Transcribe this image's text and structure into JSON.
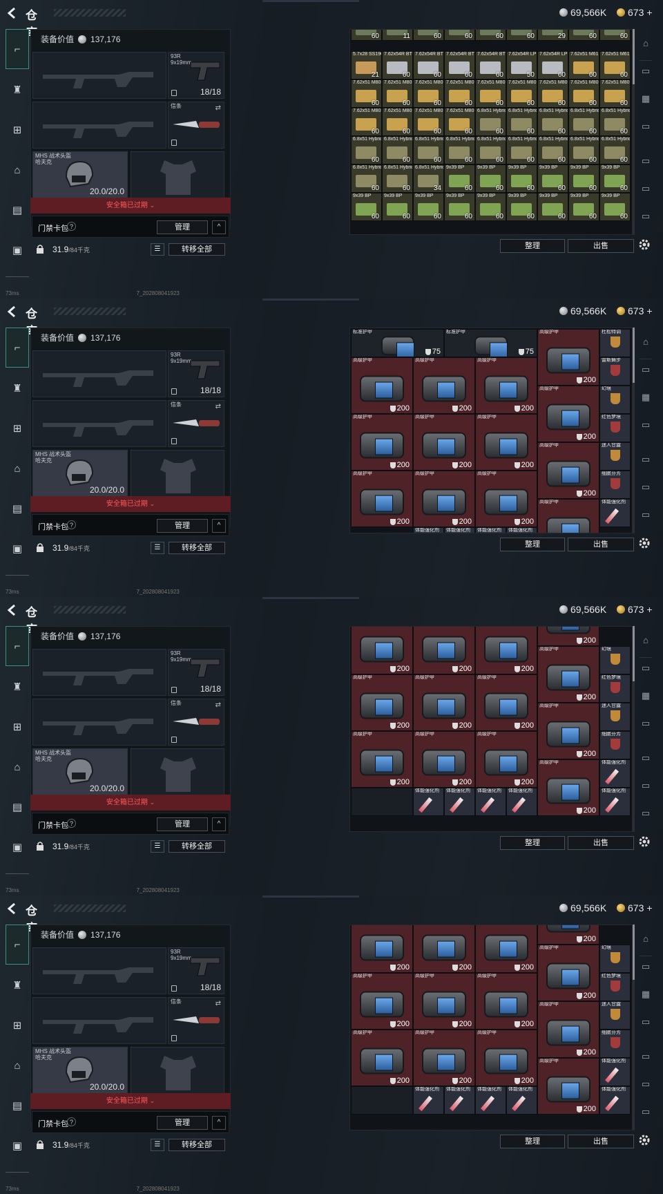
{
  "header": {
    "title": "仓库",
    "silver": "69,566K",
    "gold": "673",
    "gold_plus": "+"
  },
  "equipment": {
    "value_label": "装备价值",
    "value": "137,176",
    "secondary_name": "93R",
    "secondary_ammo": "9x19mm",
    "secondary_count": "18/18",
    "melee_name": "信条",
    "helmet_name": "MHS 战术头盔",
    "helmet_sub": "哈夫克",
    "helmet_durability": "20.0/20.0"
  },
  "safe_box": {
    "expired": "安全箱已过期"
  },
  "card_pack": {
    "label": "门禁卡包",
    "help": "?",
    "manage": "管理",
    "collapse": "^"
  },
  "weight": {
    "value": "31.9",
    "cap": "/84千克"
  },
  "buttons": {
    "transfer_all": "转移全部",
    "sort": "整理",
    "sell": "出售"
  },
  "status": {
    "ping": "73ms",
    "build": "7_202808041923"
  },
  "icons": [
    "back-icon",
    "silver-coin-icon",
    "gold-coin-icon",
    "gun-icon",
    "armor-icon",
    "rig-icon",
    "backpack-icon",
    "case-icon",
    "briefcase-icon",
    "lock-icon",
    "list-icon",
    "gear-icon"
  ],
  "frames": [
    {
      "id": "ammo",
      "cells": [
        [
          "",
          "60"
        ],
        [
          "",
          "11"
        ],
        [
          "",
          "60"
        ],
        [
          "",
          "60"
        ],
        [
          "",
          "60"
        ],
        [
          "",
          "60"
        ],
        [
          "",
          "29"
        ],
        [
          "",
          "60"
        ],
        [
          "",
          "60"
        ],
        [
          "5.7x28 SS190",
          "21"
        ],
        [
          "7.62x54R BT",
          "60"
        ],
        [
          "7.62x54R BT",
          "60"
        ],
        [
          "7.62x54R BT",
          "60"
        ],
        [
          "7.62x54R BT",
          "60"
        ],
        [
          "7.62x54R LPS",
          "50"
        ],
        [
          "7.62x54R LPS",
          "60"
        ],
        [
          "7.62x51 M61",
          "60"
        ],
        [
          "7.62x51 M61",
          "60"
        ],
        [
          "7.62x51 M80",
          "60"
        ],
        [
          "7.62x51 M80",
          "60"
        ],
        [
          "7.62x51 M80",
          "60"
        ],
        [
          "7.62x51 M80",
          "60"
        ],
        [
          "7.62x51 M80",
          "60"
        ],
        [
          "7.62x51 M80",
          "60"
        ],
        [
          "7.62x51 M80",
          "60"
        ],
        [
          "7.62x51 M80",
          "60"
        ],
        [
          "7.62x51 M80",
          "60"
        ],
        [
          "7.62x51 M80",
          "60"
        ],
        [
          "7.62x51 M80",
          "60"
        ],
        [
          "7.62x51 M80",
          "60"
        ],
        [
          "7.62x51 M80",
          "60"
        ],
        [
          "6.8x51 Hybrid",
          "60"
        ],
        [
          "6.8x51 Hybrid",
          "60"
        ],
        [
          "6.8x51 Hybrid",
          "60"
        ],
        [
          "6.8x51 Hybrid",
          "60"
        ],
        [
          "6.8x51 Hybrid",
          "60"
        ],
        [
          "6.8x51 Hybrid",
          "60"
        ],
        [
          "6.8x51 Hybrid",
          "60"
        ],
        [
          "6.8x51 Hybrid",
          "60"
        ],
        [
          "6.8x51 Hybrid",
          "60"
        ],
        [
          "6.8x51 Hybrid",
          "60"
        ],
        [
          "6.8x51 Hybrid",
          "60"
        ],
        [
          "6.8x51 Hybrid",
          "60"
        ],
        [
          "6.8x51 Hybrid",
          "60"
        ],
        [
          "6.8x51 Hybrid",
          "60"
        ],
        [
          "6.8x51 Hybrid",
          "60"
        ],
        [
          "6.8x51 Hybrid",
          "60"
        ],
        [
          "6.8x51 Hybrid",
          "34"
        ],
        [
          "9x39 BP",
          "60"
        ],
        [
          "9x39 BP",
          "60"
        ],
        [
          "9x39 BP",
          "60"
        ],
        [
          "9x39 BP",
          "60"
        ],
        [
          "9x39 BP",
          "60"
        ],
        [
          "9x39 BP",
          "60"
        ],
        [
          "9x39 BP",
          "60"
        ],
        [
          "9x39 BP",
          "60"
        ],
        [
          "9x39 BP",
          "60"
        ],
        [
          "9x39 BP",
          "60"
        ],
        [
          "9x39 BP",
          "60"
        ],
        [
          "9x39 BP",
          "60"
        ],
        [
          "9x39 BP",
          "60"
        ],
        [
          "9x39 BP",
          "60"
        ],
        [
          "9x39 BP",
          "60"
        ]
      ]
    },
    {
      "id": "armor1",
      "top": [
        {
          "name": "标准护甲",
          "val": "75"
        },
        {
          "name": "标准护甲",
          "val": "75"
        }
      ],
      "heavy_label": "高级护甲",
      "heavy_val": "200",
      "side": [
        "杜松特调",
        "雷斯舞步",
        "幻境",
        "红色梦境",
        "迷人甘露",
        "细腻芬芳",
        "体能强化剂"
      ],
      "bottom": "体能强化剂"
    },
    {
      "id": "armor2",
      "heavy_label": "高级护甲",
      "heavy_val": "200",
      "side": [
        "幻境",
        "红色梦境",
        "迷人甘露",
        "细腻芬芳",
        "体能强化剂",
        "体能强化剂"
      ],
      "bottom": "体能强化剂"
    },
    {
      "id": "armor3",
      "heavy_label": "高级护甲",
      "heavy_val": "200",
      "side": [
        "幻境",
        "红色梦境",
        "迷人甘露",
        "细腻芬芳",
        "体能强化剂",
        "体能强化剂"
      ],
      "bottom": "体能强化剂"
    }
  ]
}
